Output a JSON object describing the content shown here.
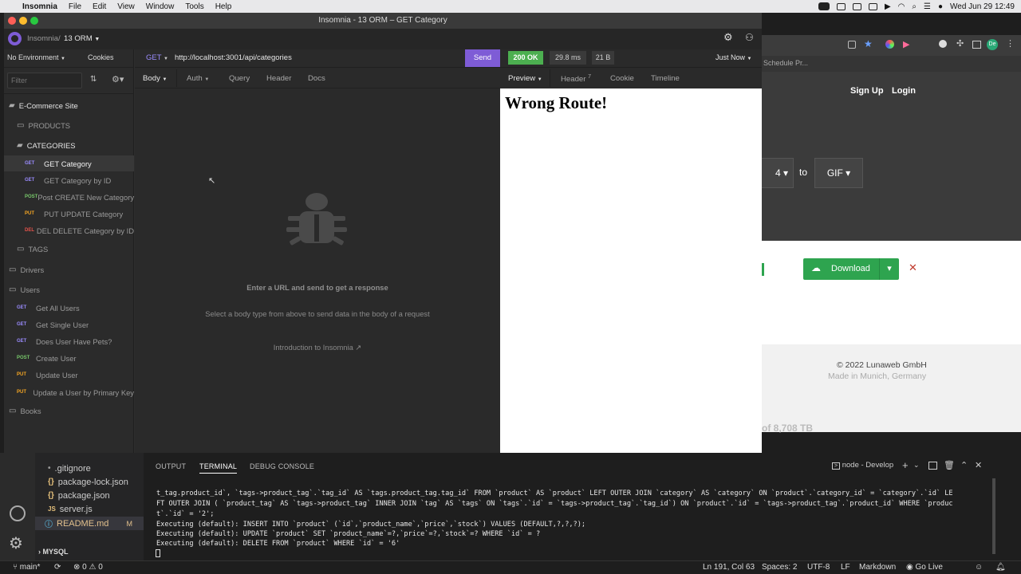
{
  "menubar": {
    "app": "Insomnia",
    "items": [
      "File",
      "Edit",
      "View",
      "Window",
      "Tools",
      "Help"
    ],
    "clock": "Wed Jun 29  12:49"
  },
  "browser": {
    "bookmark": "Schedule Pr...",
    "nav": [
      "Sign Up",
      "Login"
    ],
    "convert_from": "4",
    "convert_to_label": "to",
    "convert_to": "GIF",
    "download": "Download",
    "footer_copy": "© 2022 Lunaweb GmbH",
    "footer_sub": "Made in Munich, Germany",
    "stat": "of 8,708 TB"
  },
  "insomnia": {
    "title": "Insomnia - 13 ORM – GET Category",
    "breadcrumb_root": "Insomnia",
    "breadcrumb_sep": "/",
    "workspace": "13 ORM",
    "environment": "No Environment",
    "cookies": "Cookies",
    "filter_placeholder": "Filter",
    "method": "GET",
    "url": "http://localhost:3001/api/categories",
    "send": "Send",
    "status": "200 OK",
    "time": "29.8 ms",
    "size": "21 B",
    "just_now": "Just Now",
    "req_tabs": [
      "Body",
      "Auth",
      "Query",
      "Header",
      "Docs"
    ],
    "resp_tabs": [
      "Preview",
      "Header",
      "Cookie",
      "Timeline"
    ],
    "header_count": "7",
    "response_body": "Wrong Route!",
    "empty_title": "Enter a URL and send to get a response",
    "empty_sub": "Select a body type from above to send data in the body of a request",
    "intro_link": "Introduction to Insomnia",
    "tree": {
      "root": "E-Commerce Site",
      "products": "PRODUCTS",
      "categories": "CATEGORIES",
      "cat_reqs": [
        {
          "verb": "GET",
          "label": "GET Category"
        },
        {
          "verb": "GET",
          "label": "GET Category by ID"
        },
        {
          "verb": "POST",
          "label": "Post CREATE New Category"
        },
        {
          "verb": "PUT",
          "label": "PUT UPDATE Category"
        },
        {
          "verb": "DEL",
          "label": "DEL DELETE Category by ID"
        }
      ],
      "tags": "TAGS",
      "drivers": "Drivers",
      "users": "Users",
      "user_reqs": [
        {
          "verb": "GET",
          "label": "Get All Users"
        },
        {
          "verb": "GET",
          "label": "Get Single User"
        },
        {
          "verb": "GET",
          "label": "Does User Have Pets?"
        },
        {
          "verb": "POST",
          "label": "Create User"
        },
        {
          "verb": "PUT",
          "label": "Update User"
        },
        {
          "verb": "PUT",
          "label": "Update a User by Primary Key"
        }
      ],
      "books": "Books"
    }
  },
  "vscode": {
    "explorer": [
      {
        "icon": "•",
        "label": ".gitignore"
      },
      {
        "icon": "{}",
        "label": "package-lock.json"
      },
      {
        "icon": "{}",
        "label": "package.json"
      },
      {
        "icon": "JS",
        "label": "server.js"
      },
      {
        "icon": "ⓘ",
        "label": "README.md",
        "badge": "M"
      }
    ],
    "mysql": "MYSQL",
    "panel_tabs": [
      "OUTPUT",
      "TERMINAL",
      "DEBUG CONSOLE"
    ],
    "terminal_name": "node - Develop",
    "terminal_lines": [
      "t_tag.product_id`, `tags->product_tag`.`tag_id` AS `tags.product_tag.tag_id` FROM `product` AS `product` LEFT OUTER JOIN `category` AS `category` ON `product`.`category_id` = `category`.`id` LE",
      "FT OUTER JOIN ( `product_tag` AS `tags->product_tag` INNER JOIN `tag` AS `tags` ON `tags`.`id` = `tags->product_tag`.`tag_id`) ON `product`.`id` = `tags->product_tag`.`product_id` WHERE `produc",
      "t`.`id` = '2';",
      "Executing (default): INSERT INTO `product` (`id`,`product_name`,`price`,`stock`) VALUES (DEFAULT,?,?,?);",
      "Executing (default): UPDATE `product` SET `product_name`=?,`price`=?,`stock`=? WHERE `id` = ?",
      "Executing (default): DELETE FROM `product` WHERE `id` = '6'"
    ],
    "status": {
      "branch": "main*",
      "problems": "0",
      "warnings": "0",
      "position": "Ln 191, Col 63",
      "spaces": "Spaces: 2",
      "encoding": "UTF-8",
      "eol": "LF",
      "language": "Markdown",
      "golive": "Go Live"
    }
  }
}
